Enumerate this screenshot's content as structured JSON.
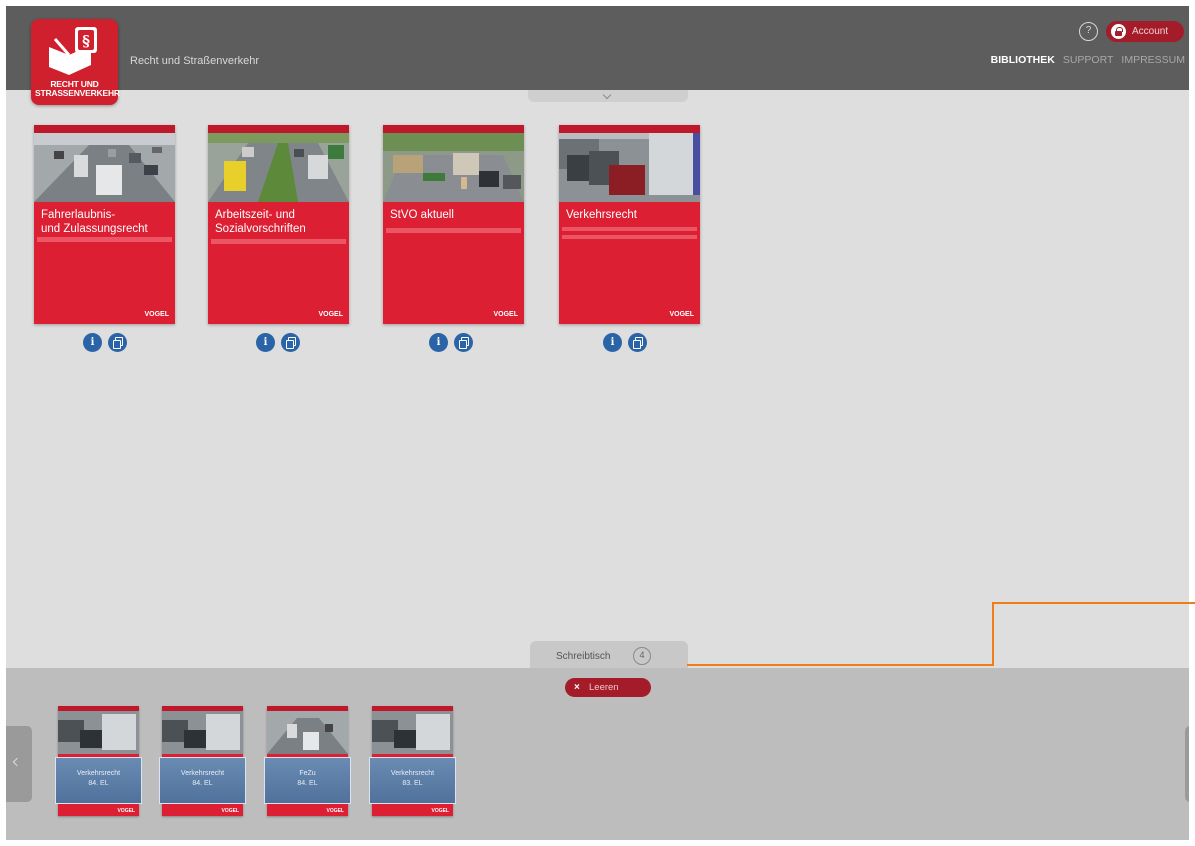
{
  "header": {
    "logo_text_line1": "RECHT UND",
    "logo_text_line2": "STRASSENVERKEHR",
    "app_title": "Recht und Straßenverkehr",
    "help_label": "?",
    "account_label": "Account",
    "nav": [
      "BIBLIOTHEK",
      "SUPPORT",
      "IMPRESSUM"
    ],
    "active_nav": "BIBLIOTHEK"
  },
  "books": [
    {
      "title_line1": "Fahrerlaubnis-",
      "title_line2": "und Zulassungsrecht",
      "brand": "VOGEL"
    },
    {
      "title_line1": "Arbeitszeit- und",
      "title_line2": "Sozialvorschriften",
      "brand": "VOGEL"
    },
    {
      "title_line1": "StVO aktuell",
      "title_line2": "",
      "brand": "VOGEL"
    },
    {
      "title_line1": "Verkehrsrecht",
      "title_line2": "",
      "brand": "VOGEL"
    }
  ],
  "book_actions": {
    "info_label": "i"
  },
  "desk": {
    "label": "Schreibtisch",
    "count": "4",
    "clear_icon": "×",
    "clear_label": "Leeren",
    "items": [
      {
        "line1": "Verkehrsrecht",
        "line2": "84. EL",
        "brand": "VOGEL"
      },
      {
        "line1": "Verkehrsrecht",
        "line2": "84. EL",
        "brand": "VOGEL"
      },
      {
        "line1": "FeZu",
        "line2": "84. EL",
        "brand": "VOGEL"
      },
      {
        "line1": "Verkehrsrecht",
        "line2": "83. EL",
        "brand": "VOGEL"
      }
    ]
  },
  "colors": {
    "header_bg": "#5d5d5d",
    "brand_red": "#dc1f33",
    "button_red": "#a41c2a",
    "info_blue": "#2a64a6",
    "callout_orange": "#f07c1a"
  }
}
